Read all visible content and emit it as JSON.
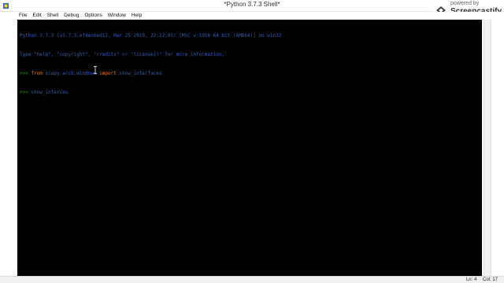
{
  "window": {
    "title": "*Python 3.7.3 Shell*"
  },
  "watermark": {
    "powered": "powered by",
    "brand": "Screencastify"
  },
  "menu": {
    "items": [
      "File",
      "Edit",
      "Shell",
      "Debug",
      "Options",
      "Window",
      "Help"
    ]
  },
  "shell": {
    "banner_line1": "Python 3.7.3 (v3.7.3:ef4ec6ed12, Mar 25 2019, 22:22:05) [MSC v.1916 64 bit (AMD64)] on win32",
    "banner_line2": "Type \"help\", \"copyright\", \"credits\" or \"license()\" for more information.",
    "prompt": ">>> ",
    "cmd1_kw_from": "from",
    "cmd1_module": " scapy.arch.windows ",
    "cmd1_kw_import": "import",
    "cmd1_name": " show_interfaces",
    "cmd2": "show_interces"
  },
  "status": {
    "line": "Ln: 4",
    "col": "Col: 17"
  },
  "colors": {
    "shell_bg": "#000000",
    "banner": "#2f5fbf",
    "keyword": "#ff7700",
    "prompt": "#00aa00"
  },
  "icons": {
    "app": "python-idle-icon",
    "watermark": "screencastify-logo",
    "cursor": "i-beam-cursor"
  }
}
